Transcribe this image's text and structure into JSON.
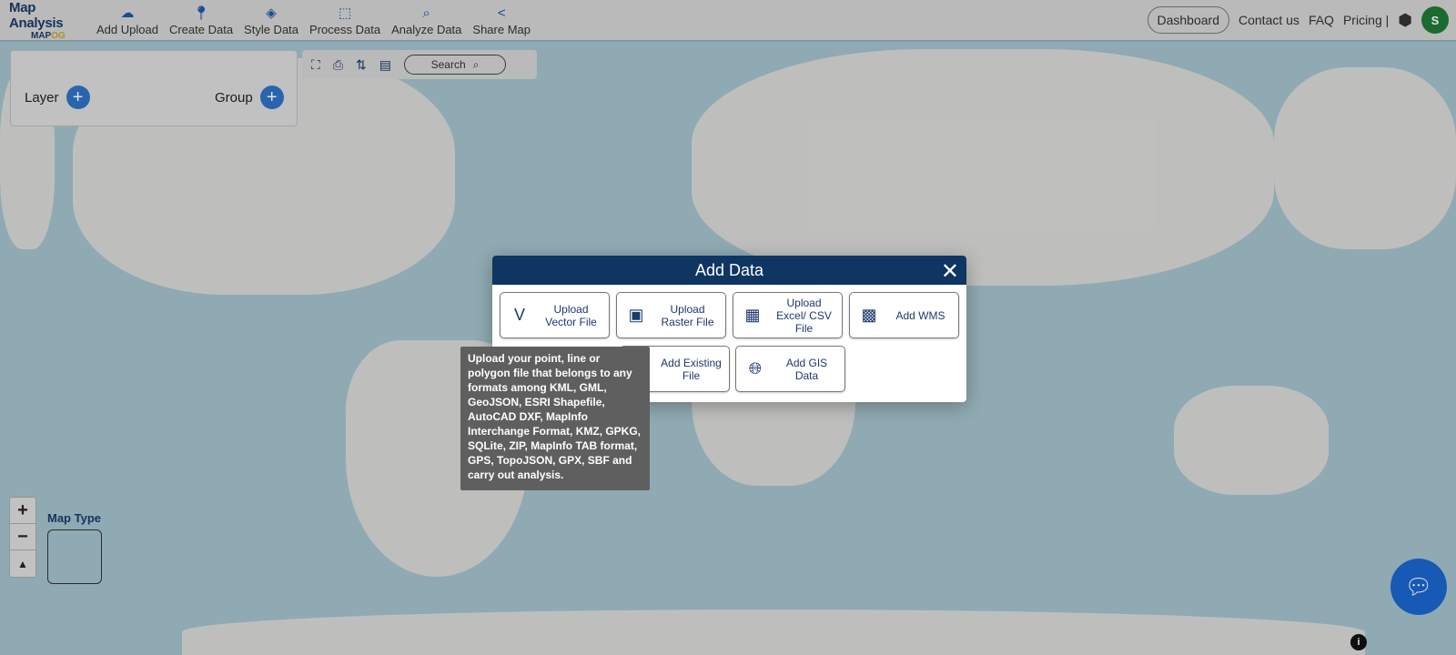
{
  "header": {
    "brand_title": "Map Analysis",
    "brand_sub_a": "MAP",
    "brand_sub_b": "OG",
    "nav": [
      {
        "label": "Add Upload",
        "icon": "cloud-upload-icon"
      },
      {
        "label": "Create Data",
        "icon": "map-pin-icon"
      },
      {
        "label": "Style Data",
        "icon": "paint-bucket-icon"
      },
      {
        "label": "Process Data",
        "icon": "process-icon"
      },
      {
        "label": "Analyze Data",
        "icon": "analyze-icon"
      },
      {
        "label": "Share Map",
        "icon": "share-icon"
      }
    ],
    "dashboard": "Dashboard",
    "contact": "Contact us",
    "faq": "FAQ",
    "pricing": "Pricing |",
    "avatar": "S"
  },
  "layer_panel": {
    "layer": "Layer",
    "group": "Group"
  },
  "toolbar": {
    "search": "Search"
  },
  "map": {
    "map_type": "Map Type",
    "zoom_in": "+",
    "zoom_out": "−",
    "reset": "▲"
  },
  "modal": {
    "title": "Add Data",
    "options": [
      {
        "label": "Upload Vector File",
        "icon": "vector-icon"
      },
      {
        "label": "Upload Raster File",
        "icon": "raster-image-icon"
      },
      {
        "label": "Upload Excel/ CSV File",
        "icon": "spreadsheet-icon"
      },
      {
        "label": "Add WMS",
        "icon": "wms-icon"
      },
      {
        "label": "Add Existing File",
        "icon": "file-icon"
      },
      {
        "label": "Add GIS Data",
        "icon": "globe-icon"
      }
    ],
    "tooltip": "Upload your point, line or polygon file that belongs to any formats among KML, GML, GeoJSON, ESRI Shapefile, AutoCAD DXF, MapInfo Interchange Format, KMZ, GPKG, SQLite, ZIP, MapInfo TAB format, GPS, TopoJSON, GPX, SBF and carry out analysis."
  },
  "colors": {
    "modal_header": "#0f3563",
    "accent": "#2f74c7",
    "avatar": "#1e7a36",
    "chat": "#1a67d0"
  }
}
